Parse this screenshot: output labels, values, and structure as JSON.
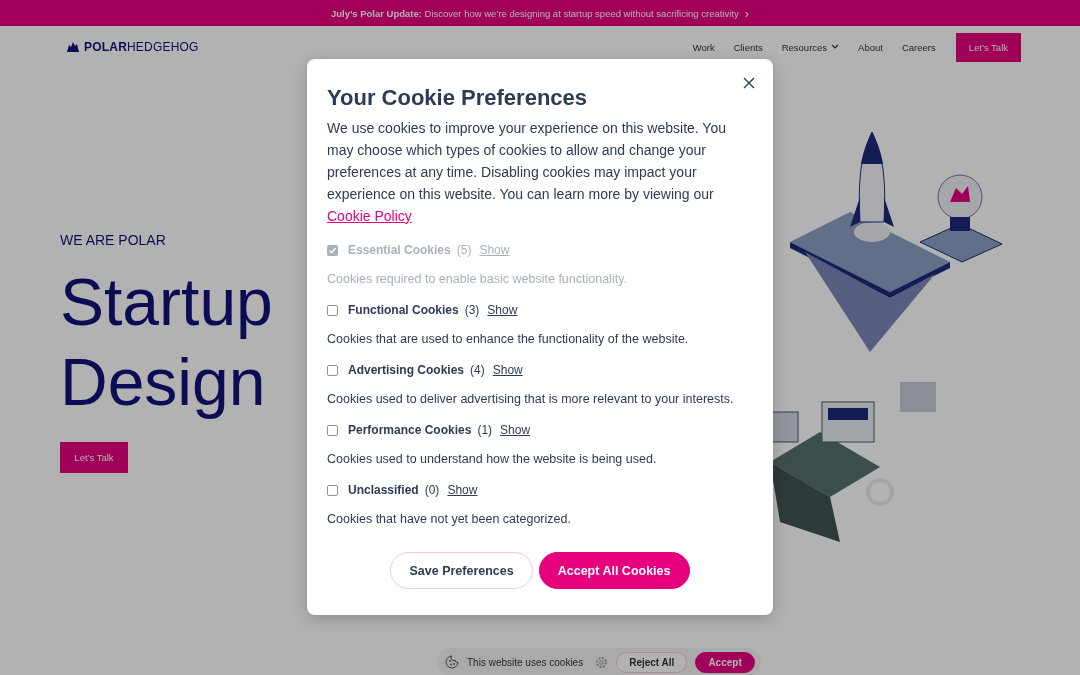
{
  "announcement": {
    "text": "**July’s Polar Update:** Discover how we’re designing at startup speed without sacrificing creativity",
    "chevron": "›"
  },
  "header": {
    "logo": "**POLAR**HEDGEHOG",
    "nav": [
      {
        "label": "Work",
        "has_menu": false
      },
      {
        "label": "Clients",
        "has_menu": false
      },
      {
        "label": "Resources",
        "has_menu": true
      },
      {
        "label": "About",
        "has_menu": false
      },
      {
        "label": "Careers",
        "has_menu": false
      }
    ],
    "cta": "Let’s Talk"
  },
  "hero": {
    "eyebrow": "WE ARE POLAR",
    "heading": "Startup Design",
    "button": "Let’s Talk"
  },
  "cookie_modal": {
    "title": "Your Cookie Preferences",
    "intro": "We use cookies to improve your experience on this website. You may choose which types of cookies to allow and change your preferences at any time. Disabling cookies may impact your experience on this website. You can learn more by viewing our",
    "policy_link": "Cookie Policy",
    "categories": [
      {
        "name": "Essential Cookies",
        "count": "(5)",
        "toggle": "Show",
        "description": "Cookies required to enable basic website functionality.",
        "checked": true,
        "disabled": true
      },
      {
        "name": "Functional Cookies",
        "count": "(3)",
        "toggle": "Show",
        "description": "Cookies that are used to enhance the functionality of the website.",
        "checked": false,
        "disabled": false
      },
      {
        "name": "Advertising Cookies",
        "count": "(4)",
        "toggle": "Show",
        "description": "Cookies used to deliver advertising that is more relevant to your interests.",
        "checked": false,
        "disabled": false
      },
      {
        "name": "Performance Cookies",
        "count": "(1)",
        "toggle": "Show",
        "description": "Cookies used to understand how the website is being used.",
        "checked": false,
        "disabled": false
      },
      {
        "name": "Unclassified",
        "count": "(0)",
        "toggle": "Show",
        "description": "Cookies that have not yet been categorized.",
        "checked": false,
        "disabled": false
      }
    ],
    "buttons": [
      {
        "label": "Save Preferences",
        "kind": "outline"
      },
      {
        "label": "Accept All Cookies",
        "kind": "primary"
      }
    ]
  },
  "cookie_bar": {
    "text": "This website uses cookies",
    "buttons": [
      {
        "label": "Reject All",
        "kind": "outline"
      },
      {
        "label": "Accept",
        "kind": "primary"
      }
    ]
  }
}
